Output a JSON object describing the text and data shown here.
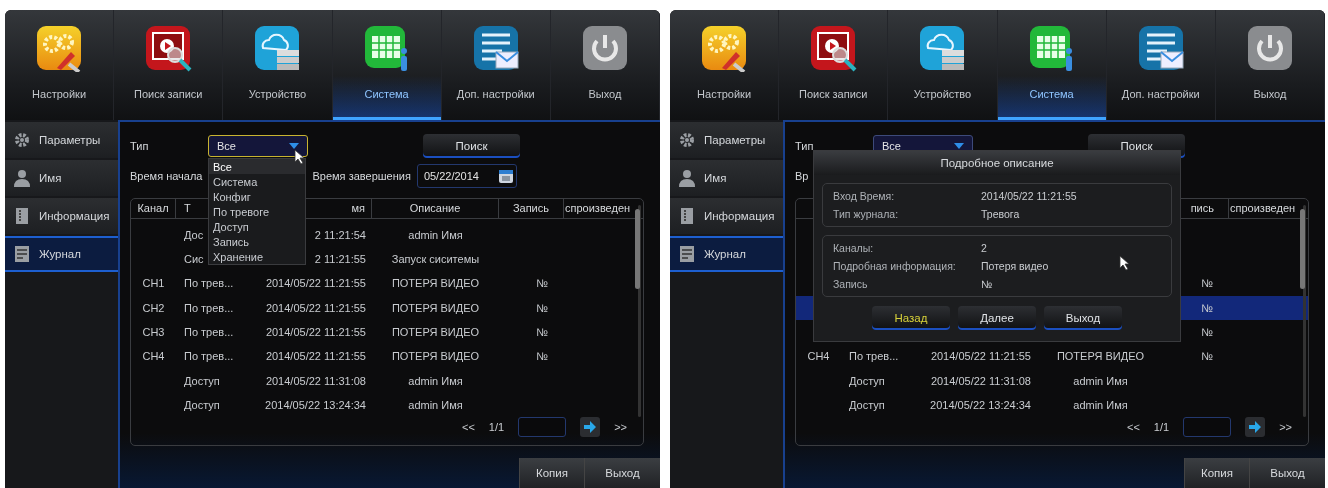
{
  "screens": [
    {
      "nav": [
        {
          "kind": "settings",
          "label": "Настройки",
          "selected": false
        },
        {
          "kind": "search",
          "label": "Поиск записи",
          "selected": false
        },
        {
          "kind": "device",
          "label": "Устройство",
          "selected": false
        },
        {
          "kind": "system",
          "label": "Система",
          "selected": true
        },
        {
          "kind": "advanced",
          "label": "Доп. настройки",
          "selected": false
        },
        {
          "kind": "exit",
          "label": "Выход",
          "selected": false
        }
      ],
      "sidebar": [
        {
          "kind": "params",
          "label": "Параметры",
          "selected": false
        },
        {
          "kind": "user",
          "label": "Имя",
          "selected": false
        },
        {
          "kind": "info",
          "label": "Информация",
          "selected": false
        },
        {
          "kind": "log",
          "label": "Журнал",
          "selected": true
        }
      ],
      "filter": {
        "type_label": "Тип",
        "type_value": "Все",
        "search_button": "Поиск",
        "start_label": "Время начала",
        "end_label": "Время завершения",
        "end_date": "05/22/2014"
      },
      "dropdown": {
        "options": [
          {
            "label": "Все",
            "selected": true
          },
          {
            "label": "Система",
            "selected": false
          },
          {
            "label": "Конфиг",
            "selected": false
          },
          {
            "label": "По тревоге",
            "selected": false
          },
          {
            "label": "Доступ",
            "selected": false
          },
          {
            "label": "Запись",
            "selected": false
          },
          {
            "label": "Хранение",
            "selected": false
          }
        ]
      },
      "table": {
        "columns": {
          "channel": "Канал",
          "type": "Т",
          "time": "мя",
          "description": "Описание",
          "record": "Запись",
          "playback": "спроизведен"
        },
        "rows": [
          {
            "type": "Дос",
            "time": "2 11:21:54",
            "description": "admin Имя",
            "selected": false
          },
          {
            "type": "Сис",
            "time": "2 11:21:55",
            "description": "Запуск сиситемы",
            "selected": false
          },
          {
            "channel": "CH1",
            "type": "По трев...",
            "time": "2014/05/22 11:21:55",
            "description": "ПОТЕРЯ ВИДЕО",
            "record": "№",
            "selected": false
          },
          {
            "channel": "CH2",
            "type": "По трев...",
            "time": "2014/05/22 11:21:55",
            "description": "ПОТЕРЯ ВИДЕО",
            "record": "№",
            "selected": false
          },
          {
            "channel": "CH3",
            "type": "По трев...",
            "time": "2014/05/22 11:21:55",
            "description": "ПОТЕРЯ ВИДЕО",
            "record": "№",
            "selected": false
          },
          {
            "channel": "CH4",
            "type": "По трев...",
            "time": "2014/05/22 11:21:55",
            "description": "ПОТЕРЯ ВИДЕО",
            "record": "№",
            "selected": false
          },
          {
            "type": "Доступ",
            "time": "2014/05/22 11:31:08",
            "description": "admin Имя",
            "selected": false
          },
          {
            "type": "Доступ",
            "time": "2014/05/22 13:24:34",
            "description": "admin Имя",
            "selected": false
          }
        ]
      },
      "pager": {
        "first": "<<",
        "page": "1/1",
        "last": ">>"
      },
      "buttons": [
        "Копия",
        "Выход"
      ]
    },
    {
      "nav": [
        {
          "kind": "settings",
          "label": "Настройки",
          "selected": false
        },
        {
          "kind": "search",
          "label": "Поиск записи",
          "selected": false
        },
        {
          "kind": "device",
          "label": "Устройство",
          "selected": false
        },
        {
          "kind": "system",
          "label": "Система",
          "selected": true
        },
        {
          "kind": "advanced",
          "label": "Доп. настройки",
          "selected": false
        },
        {
          "kind": "exit",
          "label": "Выход",
          "selected": false
        }
      ],
      "sidebar": [
        {
          "kind": "params",
          "label": "Параметры",
          "selected": false
        },
        {
          "kind": "user",
          "label": "Имя",
          "selected": false
        },
        {
          "kind": "info",
          "label": "Информация",
          "selected": false
        },
        {
          "kind": "log",
          "label": "Журнал",
          "selected": true
        }
      ],
      "filter": {
        "type_label": "Тип",
        "type_value": "Все",
        "search_button": "Поиск",
        "start_label": "Вр"
      },
      "table": {
        "columns": {
          "record": "пись",
          "playback": "спроизведен"
        },
        "rows": [
          {
            "selected": false
          },
          {
            "selected": false
          },
          {
            "record": "№",
            "selected": false
          },
          {
            "record": "№",
            "selected": true
          },
          {
            "record": "№",
            "selected": false
          },
          {
            "channel": "CH4",
            "type": "По трев...",
            "time": "2014/05/22 11:21:55",
            "description": "ПОТЕРЯ ВИДЕО",
            "record": "№",
            "selected": false
          },
          {
            "type": "Доступ",
            "time": "2014/05/22 11:31:08",
            "description": "admin Имя",
            "selected": false
          },
          {
            "type": "Доступ",
            "time": "2014/05/22 13:24:34",
            "description": "admin Имя",
            "selected": false
          }
        ]
      },
      "pager": {
        "first": "<<",
        "page": "1/1",
        "last": ">>"
      },
      "buttons": [
        "Копия",
        "Выход"
      ],
      "dialog": {
        "title": "Подробное описание",
        "groups": [
          [
            {
              "label": "Вход Время:",
              "value": "2014/05/22 11:21:55"
            },
            {
              "label": "Тип журнала:",
              "value": "Тревога"
            }
          ],
          [
            {
              "label": "Каналы:",
              "value": "2"
            },
            {
              "label": "Подробная информация:",
              "value": "Потеря видео"
            },
            {
              "label": "Запись",
              "value": "№"
            }
          ]
        ],
        "buttons": [
          {
            "label": "Назад",
            "selected": true
          },
          {
            "label": "Далее",
            "selected": false
          },
          {
            "label": "Выход",
            "selected": false
          }
        ]
      }
    }
  ]
}
